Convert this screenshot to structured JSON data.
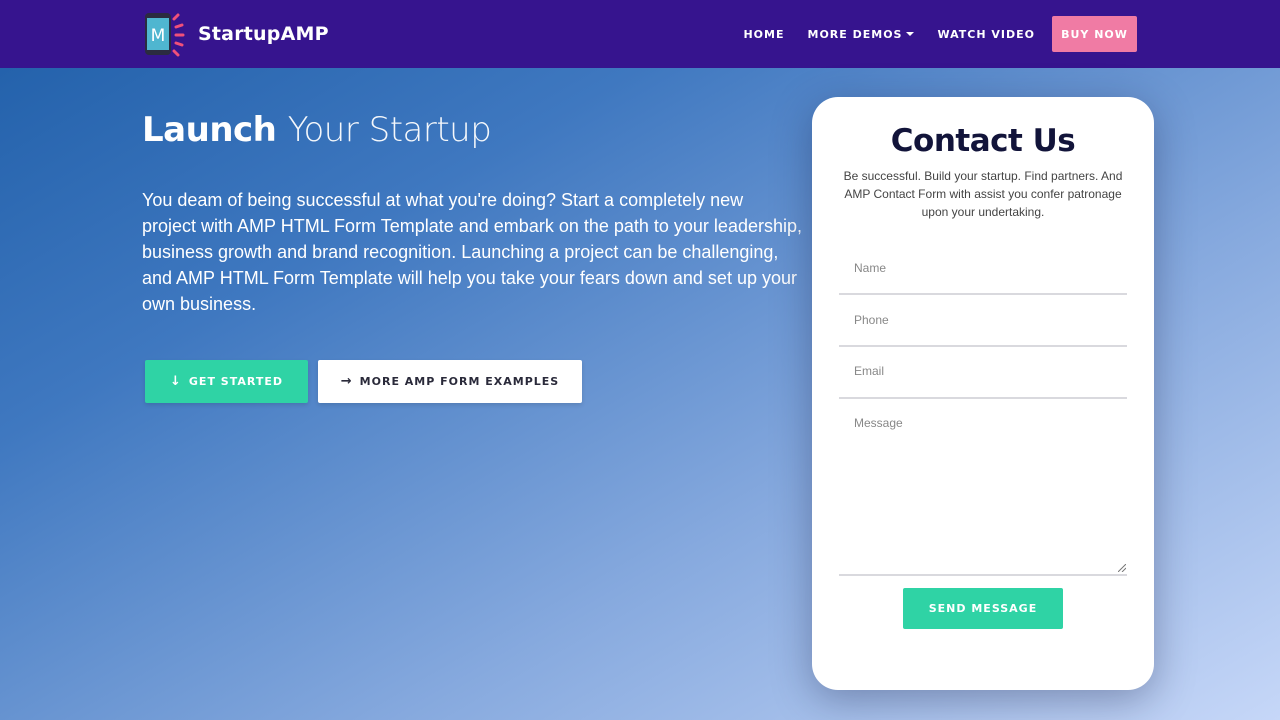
{
  "nav": {
    "brand_name": "StartupAMP",
    "brand_logo_letter": "M",
    "links": [
      {
        "label": "HOME"
      },
      {
        "label": "MORE DEMOS"
      },
      {
        "label": "WATCH VIDEO"
      }
    ],
    "buy_label": "BUY NOW"
  },
  "hero": {
    "title_strong": "Launch",
    "title_light": "Your Startup",
    "text": "You deam of being successful at what you're doing? Start a completely new project with AMP HTML Form Template and embark on the path to your leadership, business growth and brand recognition. Launching a project can be challenging, and AMP HTML Form Template will help you take your fears down and set up your own business.",
    "primary_button": {
      "icon": "↓",
      "label": "GET STARTED"
    },
    "secondary_button": {
      "icon": "→",
      "label": "MORE AMP FORM EXAMPLES"
    }
  },
  "contact": {
    "title": "Contact Us",
    "subtitle": "Be successful. Build your startup. Find partners. And AMP Contact Form with assist you confer patronage upon your undertaking.",
    "fields": {
      "name_placeholder": "Name",
      "phone_placeholder": "Phone",
      "email_placeholder": "Email",
      "message_placeholder": "Message"
    },
    "send_label": "SEND MESSAGE"
  },
  "colors": {
    "navbar": "#36148e",
    "accent_green": "#2fd3a5",
    "buy_pink": "#f07ba4",
    "title_dark": "#12143a"
  }
}
